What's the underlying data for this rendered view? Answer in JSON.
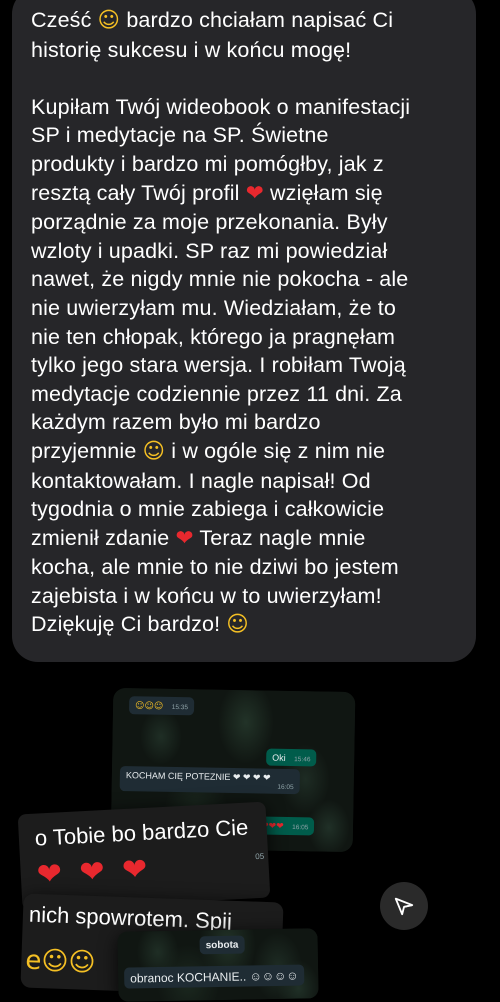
{
  "message": {
    "paragraph1": [
      "Cześć",
      "bardzo chciałam napisać Ci",
      "historię sukcesu i w końcu mogę!"
    ],
    "paragraph2": {
      "l1": "Kupiłam Twój wideobook o manifestacji",
      "l2": "SP i medytacje na SP. Świetne",
      "l3": "produkty i bardzo mi pomógłby, jak z",
      "l4a": "resztą cały Twój profil",
      "l4b": "wzięłam się",
      "l5": "porządnie za moje przekonania. Były",
      "l6": "wzloty i upadki. SP raz mi powiedział",
      "l7": "nawet, że nigdy mnie nie pokocha - ale",
      "l8": "nie uwierzyłam mu. Wiedziałam, że to",
      "l9": "nie ten chłopak, którego ja pragnęłam",
      "l10": "tylko jego stara wersja. I robiłam Twoją",
      "l11": "medytacje codziennie przez 11 dni. Za",
      "l12": "każdym razem było mi bardzo",
      "l13a": "przyjemnie",
      "l13b": "i w ogóle się z nim nie",
      "l14": "kontaktowałam. I nagle napisał! Od",
      "l15": "tygodnia o mnie zabiega i całkowicie",
      "l16a": "zmienił zdanie",
      "l16b": "Teraz nagle mnie",
      "l17": "kocha, ale mnie to nie dziwi bo jestem",
      "l18": "zajebista i w końcu w to uwierzyłam!",
      "l19": "Dziękuję Ci bardzo!"
    },
    "emojis": {
      "smile": "☺",
      "heart": "❤",
      "love_face": "☺"
    }
  },
  "collage": {
    "top": {
      "emoji_row": "☺☺☺",
      "emoji_time": "15:35",
      "oki_text": "Oki",
      "oki_time": "15:46",
      "kocham_text": "KOCHAM CIĘ POTEZNIE ❤ ❤ ❤ ❤",
      "kocham_time": "16:05",
      "hearts_text": "❤❤❤",
      "hearts_time": "16:05"
    },
    "middle": {
      "text": "o Tobie bo bardzo Cie",
      "hearts": "❤ ❤ ❤",
      "side_time": "05"
    },
    "bottom": {
      "text": "nich spowrotem. Spij",
      "emojis": "e☺☺",
      "day_label": "sobota",
      "last_msg": "obranoc KOCHANIE.. ☺☺☺☺"
    }
  }
}
